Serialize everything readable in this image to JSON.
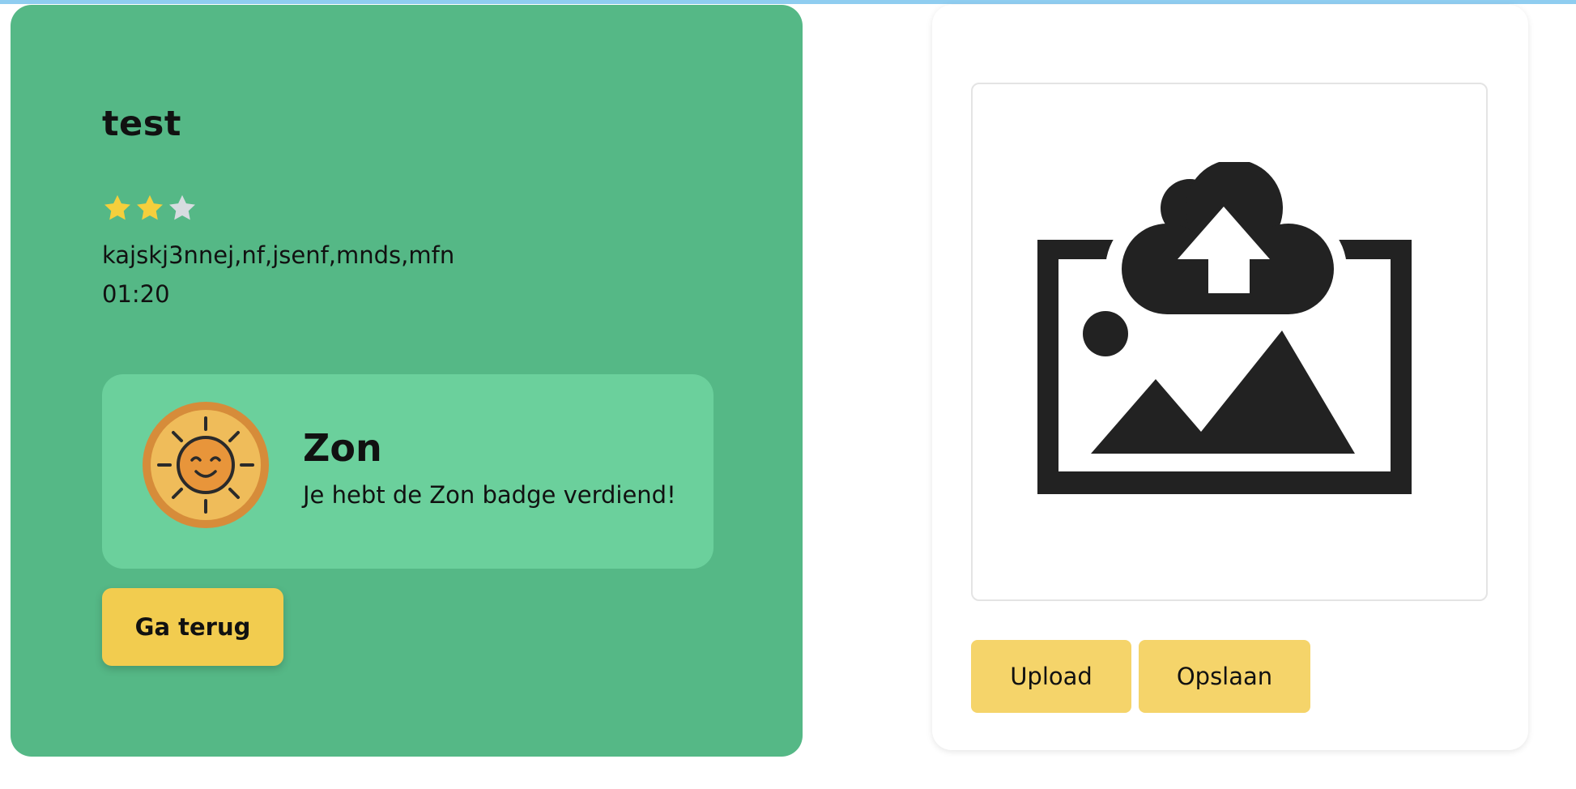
{
  "level": {
    "title": "test",
    "rating": {
      "value": 2,
      "max": 3
    },
    "description": "kajskj3nnej,nf,jsenf,mnds,mfn",
    "time": "01:20"
  },
  "badge": {
    "name": "Zon",
    "message": "Je hebt de Zon badge verdiend!",
    "icon": "sun-badge-icon"
  },
  "actions": {
    "back_label": "Ga terug",
    "upload_label": "Upload",
    "save_label": "Opslaan"
  },
  "uploader": {
    "icon": "image-upload-icon"
  },
  "colors": {
    "card_green": "#55b886",
    "badge_green": "#6bd09c",
    "button_yellow": "#f2cc4f",
    "upload_button_yellow": "#f5d46a",
    "star_filled": "#f5cf3c",
    "star_empty": "#d7dce0",
    "top_strip": "#8fcdf0"
  }
}
